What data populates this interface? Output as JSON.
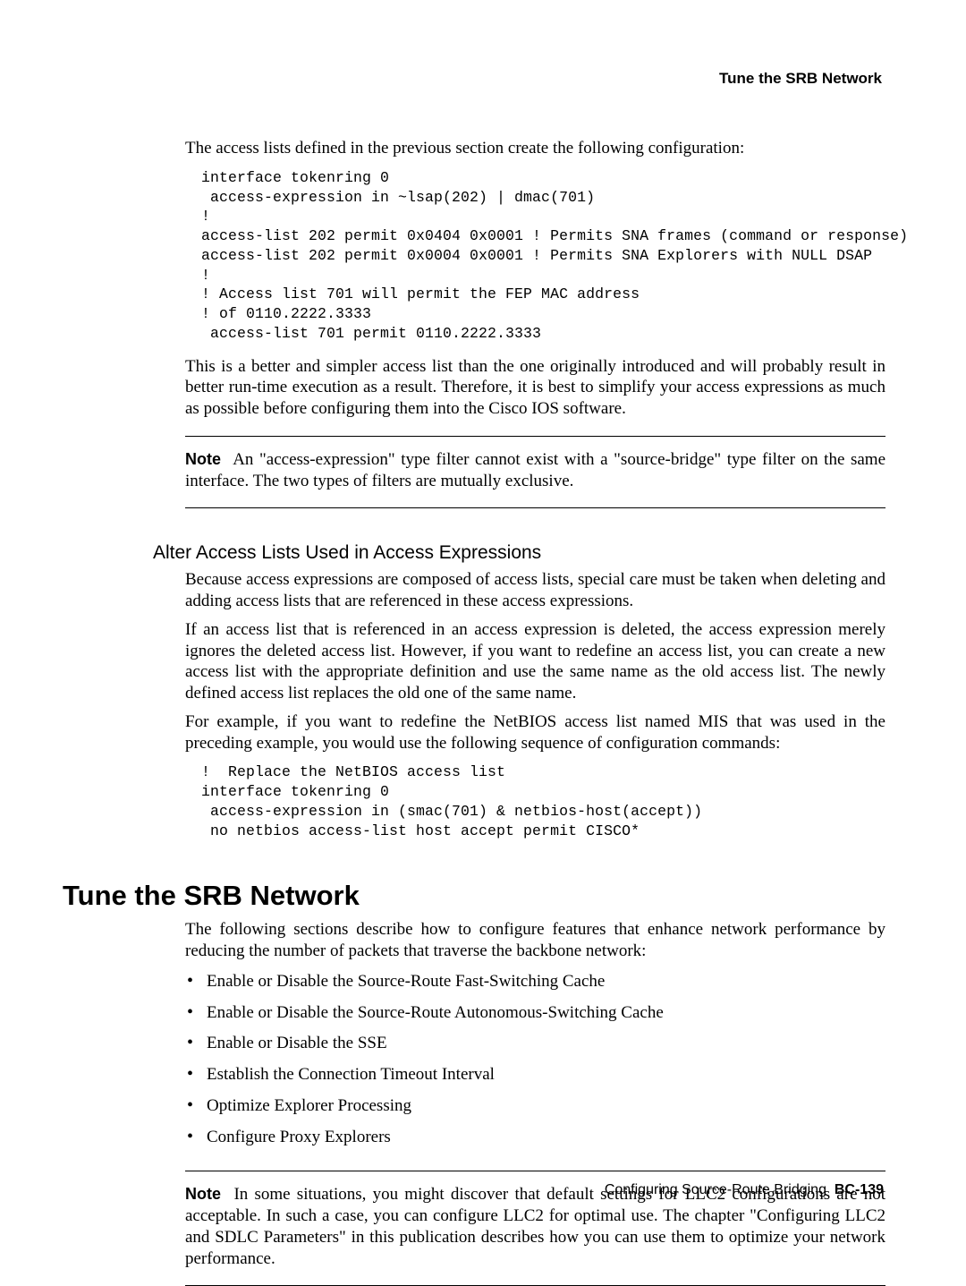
{
  "header": {
    "running_head": "Tune the SRB Network"
  },
  "section1": {
    "intro": "The access lists defined in the previous section create the following configuration:",
    "code": "interface tokenring 0\n access-expression in ~lsap(202) | dmac(701)\n!\naccess-list 202 permit 0x0404 0x0001 ! Permits SNA frames (command or response)\naccess-list 202 permit 0x0004 0x0001 ! Permits SNA Explorers with NULL DSAP\n!\n! Access list 701 will permit the FEP MAC address\n! of 0110.2222.3333\n access-list 701 permit 0110.2222.3333",
    "para2": "This is a better and simpler access list than the one originally introduced and will probably result in better run-time execution as a result. Therefore, it is best to simplify your access expressions as much as possible before configuring them into the Cisco IOS software.",
    "note_label": "Note",
    "note_text": "An \"access-expression\" type filter cannot exist with a \"source-bridge\" type filter on the same interface. The two types of filters are mutually exclusive."
  },
  "section2": {
    "heading": "Alter Access Lists Used in Access Expressions",
    "para1": "Because access expressions are composed of access lists, special care must be taken when deleting and adding access lists that are referenced in these access expressions.",
    "para2": "If an access list that is referenced in an access expression is deleted, the access expression merely ignores the deleted access list. However, if you want to redefine an access list, you can create a new access list with the appropriate definition and use the same name as the old access list. The newly defined access list replaces the old one of the same name.",
    "para3": "For example, if you want to redefine the NetBIOS access list named MIS that was used in the preceding example, you would use the following sequence of configuration commands:",
    "code": "!  Replace the NetBIOS access list\ninterface tokenring 0\n access-expression in (smac(701) & netbios-host(accept))\n no netbios access-list host accept permit CISCO*"
  },
  "section3": {
    "heading": "Tune the SRB Network",
    "intro": "The following sections describe how to configure features that enhance network performance by reducing the number of packets that traverse the backbone network:",
    "bullets": [
      "Enable or Disable the Source-Route Fast-Switching Cache",
      "Enable or Disable the Source-Route Autonomous-Switching Cache",
      "Enable or Disable the SSE",
      "Establish the Connection Timeout Interval",
      "Optimize Explorer Processing",
      "Configure Proxy Explorers"
    ],
    "note_label": "Note",
    "note_text": "In some situations, you might discover that default settings for LLC2 configurations are not acceptable. In such a case, you can configure LLC2 for optimal use. The chapter \"Configuring LLC2 and SDLC Parameters\" in this publication describes how you can use them to optimize your network performance."
  },
  "footer": {
    "chapter": "Configuring Source-Route Bridging",
    "page": "BC-139"
  }
}
